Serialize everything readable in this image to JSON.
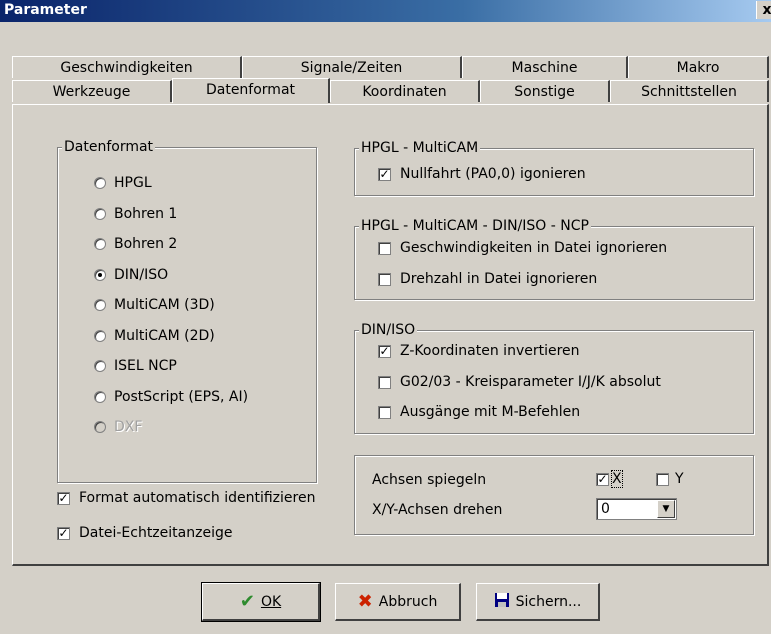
{
  "window": {
    "title": "Parameter",
    "close": "x"
  },
  "tabs_row1": [
    "Geschwindigkeiten",
    "Signale/Zeiten",
    "Maschine",
    "Makro"
  ],
  "tabs_row2": [
    "Werkzeuge",
    "Datenformat",
    "Koordinaten",
    "Sonstige",
    "Schnittstellen"
  ],
  "active_tab": "Datenformat",
  "datenformat": {
    "title": "Datenformat",
    "options": [
      "HPGL",
      "Bohren 1",
      "Bohren 2",
      "DIN/ISO",
      "MultiCAM (3D)",
      "MultiCAM (2D)",
      "ISEL NCP",
      "PostScript (EPS, AI)",
      "DXF"
    ],
    "selected": "DIN/ISO",
    "disabled": [
      "DXF"
    ]
  },
  "hpgl_group": {
    "title": "HPGL - MultiCAM",
    "nullfahrt": "Nullfahrt (PA0,0) igonieren",
    "nullfahrt_checked": true
  },
  "ncp_group": {
    "title": "HPGL - MultiCAM - DIN/ISO - NCP",
    "geschw": "Geschwindigkeiten in Datei ignorieren",
    "geschw_checked": false,
    "drehzahl": "Drehzahl in Datei ignorieren",
    "drehzahl_checked": false
  },
  "diniso_group": {
    "title": "DIN/ISO",
    "zkoord": "Z-Koordinaten invertieren",
    "zkoord_checked": true,
    "g02": "G02/03 - Kreisparameter I/J/K absolut",
    "g02_checked": false,
    "ausgaenge": "Ausgänge mit M-Befehlen",
    "ausgaenge_checked": false
  },
  "achsen": {
    "spiegeln_label": "Achsen spiegeln",
    "x_label": "X",
    "x_checked": true,
    "y_label": "Y",
    "y_checked": false,
    "drehen_label": "X/Y-Achsen drehen",
    "drehen_value": "0"
  },
  "bottom_checks": {
    "auto": "Format automatisch identifizieren",
    "auto_checked": true,
    "echtzeit": "Datei-Echtzeitanzeige",
    "echtzeit_checked": true
  },
  "buttons": {
    "ok": "OK",
    "abbruch": "Abbruch",
    "sichern": "Sichern..."
  },
  "colors": {
    "title_bar": "#0a246a",
    "face": "#d4d0c8",
    "ok_icon": "#2e8b2e",
    "cancel_icon": "#cc2200"
  }
}
